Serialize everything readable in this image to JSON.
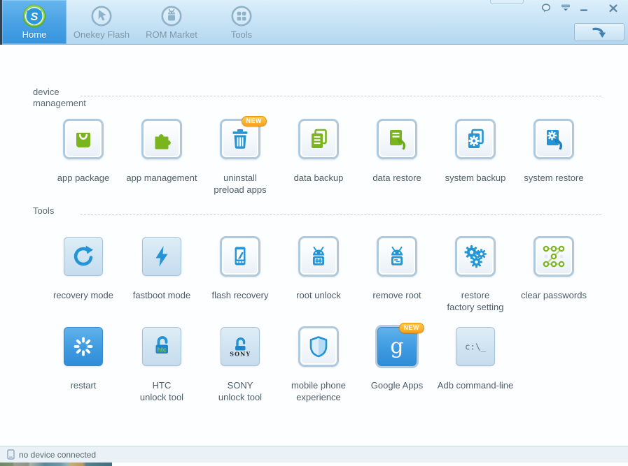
{
  "colors": {
    "accent_blue": "#3695dd",
    "icon_blue": "#2494d4",
    "icon_green": "#7ab51d",
    "badge_orange": "#f6a41e",
    "header_gradient_top": "#dceffb",
    "header_gradient_bottom": "#b3d7f0"
  },
  "nav": {
    "tabs": [
      {
        "label": "Home",
        "icon": "shuame-logo",
        "logo_letter": "S",
        "active": true
      },
      {
        "label": "Onekey Flash",
        "icon": "cursor-in-circle",
        "active": false
      },
      {
        "label": "ROM Market",
        "icon": "android-in-circle",
        "active": false
      },
      {
        "label": "Tools",
        "icon": "grid-in-circle",
        "active": false
      }
    ],
    "download_button_icon": "curved-down-arrow"
  },
  "window_controls": [
    {
      "name": "feedback",
      "icon": "speech-bubble"
    },
    {
      "name": "roll-up",
      "icon": "bar-down-triangle"
    },
    {
      "name": "minimize",
      "icon": "minus"
    },
    {
      "name": "close",
      "icon": "x"
    }
  ],
  "device_management": {
    "title": "device\nmanagement",
    "items": [
      {
        "label": "app package",
        "icon": "shopping-bag"
      },
      {
        "label": "app management",
        "icon": "puzzle-piece"
      },
      {
        "label": "uninstall\npreload apps",
        "icon": "trash-can",
        "badge": "NEW"
      },
      {
        "label": "data backup",
        "icon": "documents-stack"
      },
      {
        "label": "data restore",
        "icon": "document-return-arrow"
      },
      {
        "label": "system backup",
        "icon": "documents-gear"
      },
      {
        "label": "system restore",
        "icon": "document-gear-return-arrow"
      }
    ]
  },
  "tools": {
    "title": "Tools",
    "items": [
      {
        "label": "recovery mode",
        "icon": "circular-refresh-arrow"
      },
      {
        "label": "fastboot mode",
        "icon": "lightning-bolt"
      },
      {
        "label": "flash recovery",
        "icon": "phone-with-pencil"
      },
      {
        "label": "root unlock",
        "icon": "android-robot-hash"
      },
      {
        "label": "remove root",
        "icon": "android-robot-lines"
      },
      {
        "label": "restore\nfactory setting",
        "icon": "three-gears"
      },
      {
        "label": "clear passwords",
        "icon": "pattern-lock"
      },
      {
        "label": "restart",
        "icon": "spinner-burst"
      },
      {
        "label": "HTC\nunlock tool",
        "icon": "open-padlock-htc",
        "brand_text": "htc"
      },
      {
        "label": "SONY\nunlock tool",
        "icon": "open-padlock-sony",
        "brand_text": "SONY"
      },
      {
        "label": "mobile phone\nexperience",
        "icon": "shield"
      },
      {
        "label": "Google Apps",
        "icon": "google-g",
        "badge": "NEW",
        "glyph_text": "g"
      },
      {
        "label": "Adb command-line",
        "icon": "command-prompt",
        "glyph_text": "c:\\_"
      }
    ]
  },
  "statusbar": {
    "text": "no device connected",
    "icon": "phone"
  }
}
